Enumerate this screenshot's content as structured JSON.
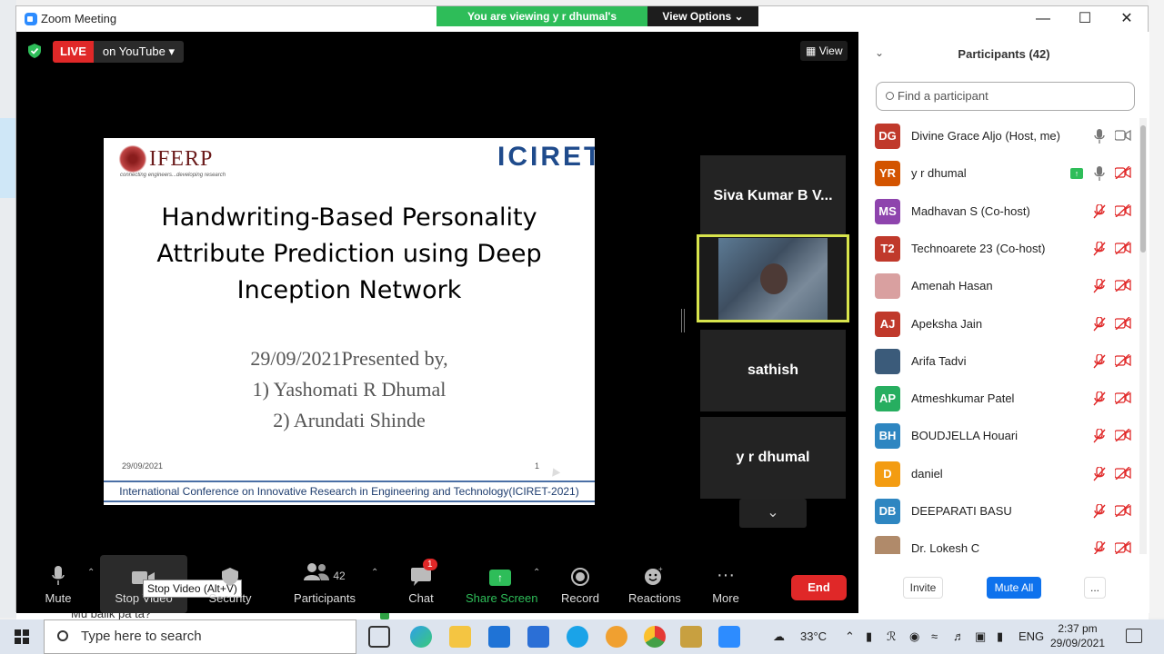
{
  "window": {
    "title": "Zoom Meeting",
    "banner_text": "You are viewing y r dhumal's screen",
    "view_options_label": "View Options ⌄"
  },
  "meeting": {
    "live_label": "LIVE",
    "live_target": "on YouTube ▾",
    "view_label": "View"
  },
  "slide": {
    "logo_left": "IFERP",
    "logo_left_tagline": "connecting engineers...developing research",
    "logo_right": "ICIRET",
    "title_lines": [
      "Handwriting-Based Personality",
      "Attribute Prediction using Deep",
      "Inception Network"
    ],
    "presented_lines": [
      "29/09/2021Presented by,",
      "1)  Yashomati R Dhumal",
      "2)  Arundati Shinde"
    ],
    "date": "29/09/2021",
    "page_number": "1",
    "footer": "International Conference on Innovative Research in Engineering and Technology(ICIRET-2021)"
  },
  "tiles": [
    "Siva Kumar B V...",
    "",
    "sathish",
    "y r dhumal"
  ],
  "toolbar": {
    "mute": "Mute",
    "stop_video": "Stop Video",
    "stop_video_tooltip": "Stop Video (Alt+V)",
    "security": "Security",
    "participants": "Participants",
    "participants_count": "42",
    "chat": "Chat",
    "chat_badge": "1",
    "share_screen": "Share Screen",
    "record": "Record",
    "reactions": "Reactions",
    "more": "More",
    "end": "End"
  },
  "panel": {
    "title": "Participants (42)",
    "search_placeholder": "Find a participant",
    "participants": [
      {
        "initials": "DG",
        "name": "Divine Grace Aljo (Host, me)",
        "color": "#c0392b",
        "muted": false,
        "video": true
      },
      {
        "initials": "YR",
        "name": "y r dhumal",
        "color": "#d35400",
        "muted": false,
        "video": false,
        "sharing": true
      },
      {
        "initials": "MS",
        "name": "Madhavan S (Co-host)",
        "color": "#8e44ad",
        "muted": true,
        "video": false
      },
      {
        "initials": "T2",
        "name": "Technoarete 23 (Co-host)",
        "color": "#c0392b",
        "muted": true,
        "video": false
      },
      {
        "initials": "",
        "name": "Amenah Hasan",
        "color": "#d9a0a0",
        "muted": true,
        "video": false
      },
      {
        "initials": "AJ",
        "name": "Apeksha Jain",
        "color": "#c0392b",
        "muted": true,
        "video": false
      },
      {
        "initials": "",
        "name": "Arifa Tadvi",
        "color": "#3b5b7a",
        "muted": true,
        "video": false
      },
      {
        "initials": "AP",
        "name": "Atmeshkumar Patel",
        "color": "#27ae60",
        "muted": true,
        "video": false
      },
      {
        "initials": "BH",
        "name": "BOUDJELLA Houari",
        "color": "#2e86c1",
        "muted": true,
        "video": false
      },
      {
        "initials": "D",
        "name": "daniel",
        "color": "#f39c12",
        "muted": true,
        "video": false
      },
      {
        "initials": "DB",
        "name": "DEEPARATI BASU",
        "color": "#2e86c1",
        "muted": true,
        "video": false
      },
      {
        "initials": "",
        "name": "Dr. Lokesh C",
        "color": "#b08a6a",
        "muted": true,
        "video": false
      }
    ],
    "invite": "Invite",
    "mute_all": "Mute All",
    "more": "..."
  },
  "taskbar": {
    "search_placeholder": "Type here to search",
    "weather": "33°C",
    "lang": "ENG",
    "time": "2:37 pm",
    "date": "29/09/2021"
  },
  "background_text": "Mu balik pa ta?"
}
